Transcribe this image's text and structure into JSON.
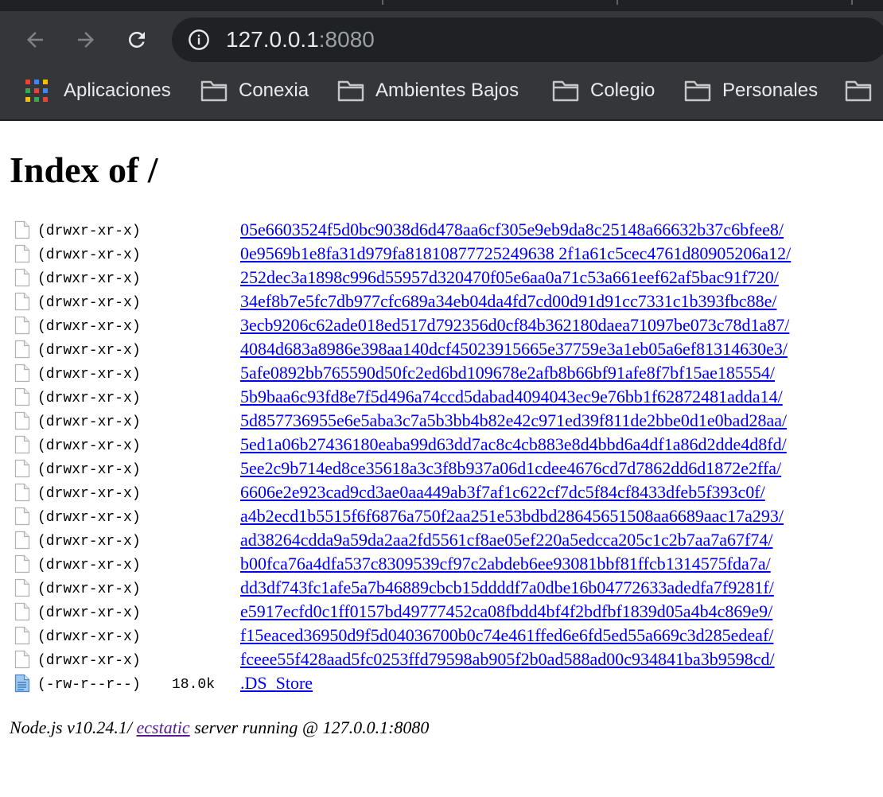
{
  "browser": {
    "address": {
      "host": "127.0.0.1",
      "port": ":8080"
    },
    "bookmarks": [
      {
        "label": "Aplicaciones",
        "icon": "apps-grid-icon"
      },
      {
        "label": "Conexia",
        "icon": "folder-icon"
      },
      {
        "label": "Ambientes Bajos",
        "icon": "folder-icon"
      },
      {
        "label": "Colegio",
        "icon": "folder-icon"
      },
      {
        "label": "Personales",
        "icon": "folder-icon"
      },
      {
        "label": "",
        "icon": "folder-icon"
      }
    ]
  },
  "page": {
    "title": "Index of /",
    "entries": [
      {
        "perms": "(drwxr-xr-x)",
        "size": "",
        "name": "05e6603524f5d0bc9038d6d478aa6cf305e9eb9da8c25148a66632b37c6bfee8/",
        "icon": "blank-file-icon"
      },
      {
        "perms": "(drwxr-xr-x)",
        "size": "",
        "name": "0e9569b1e8fa31d979fa81810877725249638 2f1a61c5cec4761d80905206a12/",
        "icon": "blank-file-icon"
      },
      {
        "perms": "(drwxr-xr-x)",
        "size": "",
        "name": "252dec3a1898c996d55957d320470f05e6aa0a71c53a661eef62af5bac91f720/",
        "icon": "blank-file-icon"
      },
      {
        "perms": "(drwxr-xr-x)",
        "size": "",
        "name": "34ef8b7e5fc7db977cfc689a34eb04da4fd7cd00d91d91cc7331c1b393fbc88e/",
        "icon": "blank-file-icon"
      },
      {
        "perms": "(drwxr-xr-x)",
        "size": "",
        "name": "3ecb9206c62ade018ed517d792356d0cf84b362180daea71097be073c78d1a87/",
        "icon": "blank-file-icon"
      },
      {
        "perms": "(drwxr-xr-x)",
        "size": "",
        "name": "4084d683a8986e398aa140dcf45023915665e37759e3a1eb05a6ef81314630e3/",
        "icon": "blank-file-icon"
      },
      {
        "perms": "(drwxr-xr-x)",
        "size": "",
        "name": "5afe0892bb765590d50fc2ed6bd109678e2afb8b66bf91afe8f7bf15ae185554/",
        "icon": "blank-file-icon"
      },
      {
        "perms": "(drwxr-xr-x)",
        "size": "",
        "name": "5b9baa6c93fd8e7f5d496a74ccd5dabad4094043ec9e76bb1f62872481adda14/",
        "icon": "blank-file-icon"
      },
      {
        "perms": "(drwxr-xr-x)",
        "size": "",
        "name": "5d857736955e6e5aba3c7a5b3bb4b82e42c971ed39f811de2bbe0d1e0bad28aa/",
        "icon": "blank-file-icon"
      },
      {
        "perms": "(drwxr-xr-x)",
        "size": "",
        "name": "5ed1a06b27436180eaba99d63dd7ac8c4cb883e8d4bbd6a4df1a86d2dde4d8fd/",
        "icon": "blank-file-icon"
      },
      {
        "perms": "(drwxr-xr-x)",
        "size": "",
        "name": "5ee2c9b714ed8ce35618a3c3f8b937a06d1cdee4676cd7d7862dd6d1872e2ffa/",
        "icon": "blank-file-icon"
      },
      {
        "perms": "(drwxr-xr-x)",
        "size": "",
        "name": "6606e2e923cad9cd3ae0aa449ab3f7af1c622cf7dc5f84cf8433dfeb5f393c0f/",
        "icon": "blank-file-icon"
      },
      {
        "perms": "(drwxr-xr-x)",
        "size": "",
        "name": "a4b2ecd1b5515f6f6876a750f2aa251e53bdbd28645651508aa6689aac17a293/",
        "icon": "blank-file-icon"
      },
      {
        "perms": "(drwxr-xr-x)",
        "size": "",
        "name": "ad38264cdda9a59da2aa2fd5561cf8ae05ef220a5edcca205c1c2b7aa7a67f74/",
        "icon": "blank-file-icon"
      },
      {
        "perms": "(drwxr-xr-x)",
        "size": "",
        "name": "b00fca76a4dfa537c8309539cf97c2abdeb6ee93081bbf81ffcb1314575fda7a/",
        "icon": "blank-file-icon"
      },
      {
        "perms": "(drwxr-xr-x)",
        "size": "",
        "name": "dd3df743fc1afe5a7b46889cbcb15ddddf7a0dbe16b04772633adedfa7f9281f/",
        "icon": "blank-file-icon"
      },
      {
        "perms": "(drwxr-xr-x)",
        "size": "",
        "name": "e5917ecfd0c1ff0157bd49777452ca08fbdd4bf4f2bdfbf1839d05a4b4c869e9/",
        "icon": "blank-file-icon"
      },
      {
        "perms": "(drwxr-xr-x)",
        "size": "",
        "name": "f15eaced36950d9f5d04036700b0c74e461ffed6e6fd5ed55a669c3d285edeaf/",
        "icon": "blank-file-icon"
      },
      {
        "perms": "(drwxr-xr-x)",
        "size": "",
        "name": "fceee55f428aad5fc0253ffd79598ab905f2b0ad588ad00c934841ba3b9598cd/",
        "icon": "blank-file-icon"
      },
      {
        "perms": "(-rw-r--r--)",
        "size": "18.0k",
        "name": ".DS_Store",
        "icon": "text-file-icon"
      }
    ],
    "footer": {
      "before": "Node.js v10.24.1/ ",
      "link": "ecstatic",
      "after": " server running @ 127.0.0.1:8080"
    }
  },
  "colors": {
    "chrome_bg": "#35363a",
    "omnibox_bg": "#202124",
    "link": "#0000ee",
    "visited_link": "#551a8b"
  }
}
